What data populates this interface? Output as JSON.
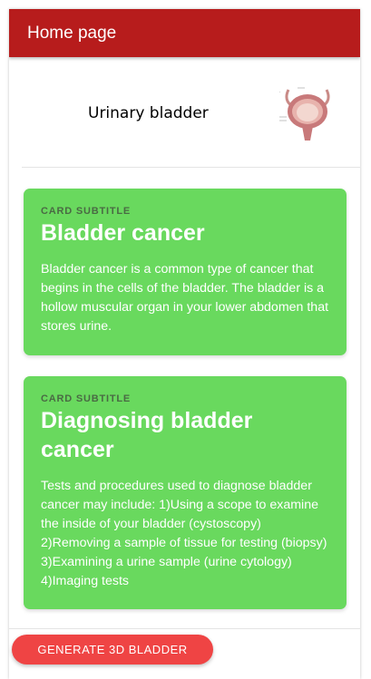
{
  "toolbar": {
    "title": "Home page",
    "color": "#b71c1c"
  },
  "header_item": {
    "label": "Urinary bladder",
    "thumbnail_icon": "bladder-anatomy-icon"
  },
  "cards": [
    {
      "subtitle": "CARD SUBTITLE",
      "title": "Bladder cancer",
      "body": "Bladder cancer is a common type of cancer that begins in the cells of the bladder. The bladder is a hollow muscular organ in your lower abdomen that stores urine."
    },
    {
      "subtitle": "CARD SUBTITLE",
      "title": "Diagnosing bladder cancer",
      "body": "Tests and procedures used to diagnose bladder cancer may include: 1)Using a scope to examine the inside of your bladder (cystoscopy) 2)Removing a sample of tissue for testing (biopsy) 3)Examining a urine sample (urine cytology) 4)Imaging tests"
    }
  ],
  "card_color": "#69d95e",
  "action_button": {
    "label": "GENERATE 3D BLADDER",
    "color": "#ef4444"
  }
}
